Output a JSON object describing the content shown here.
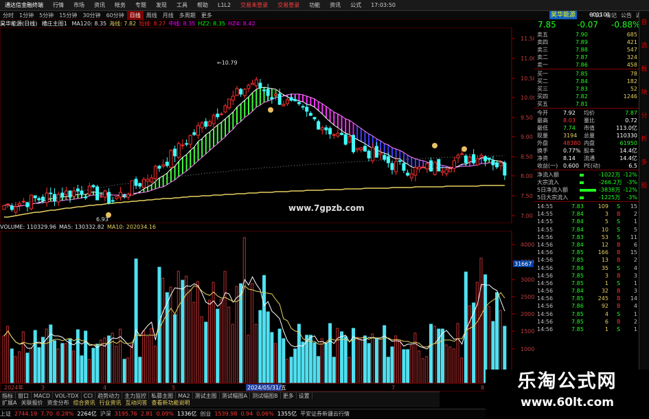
{
  "titlebar": {
    "items": [
      "通达信金融终端",
      "行情",
      "市场",
      "资讯",
      "帐务",
      "专题",
      "发现",
      "工具",
      "帮助",
      "L1L2",
      "交易未登录",
      "交易登录",
      "功能",
      "资讯",
      "公式",
      "17:03:50"
    ]
  },
  "toolbar": {
    "items": [
      "分时",
      "1分钟",
      "5分钟",
      "15分钟",
      "30分钟",
      "60分钟",
      "日线",
      "周线",
      "月线",
      "多周期",
      "更多"
    ],
    "active": 6
  },
  "rtool": {
    "items": [
      "F10",
      "标记",
      "公告",
      "返回"
    ]
  },
  "chart": {
    "stock": "昊华能源(日线)",
    "indicator": "槽庄主图1",
    "params": [
      {
        "t": "MA120: 8.35",
        "c": "#e0e0e0"
      },
      {
        "t": "海线: 7.82",
        "c": "#e8d060"
      },
      {
        "t": "短线: 8.27",
        "c": "#ff2020"
      },
      {
        "t": "中线: 8.35",
        "c": "#ff00ff"
      },
      {
        "t": "HZ2: 8.35",
        "c": "#00ff00"
      },
      {
        "t": "HZ4: 8.42",
        "c": "#ff00ff"
      }
    ],
    "yticks": [
      "11.50",
      "11.00",
      "10.50",
      "10.00",
      "9.50",
      "9.00",
      "8.50",
      "8.00",
      "7.50",
      "7.00"
    ],
    "high_label": "10.79",
    "low_label": "6.93",
    "watermark": "www.7gpzb.com"
  },
  "volume": {
    "legend": [
      {
        "t": "VOLUME: 110329.96",
        "c": "#e0e0e0"
      },
      {
        "t": "MA5: 130332.82",
        "c": "#e0e0e0"
      },
      {
        "t": "MA10: 202034.16",
        "c": "#e8d060"
      }
    ],
    "yticks": [
      "40000",
      "35000",
      "30000",
      "25000",
      "20000",
      "15000",
      "10000"
    ],
    "yunit": "X100",
    "marker": "31667",
    "dates": [
      "2024年",
      "3",
      "4",
      "5",
      "2024/05/31/五",
      "7",
      "8"
    ]
  },
  "quote": {
    "name": "昊华能源",
    "code": "601101",
    "price": "7.85",
    "change": "-0.07",
    "pct": "-0.88%",
    "sell": [
      {
        "l": "卖五",
        "p": "7.90",
        "v": "685"
      },
      {
        "l": "卖四",
        "p": "7.89",
        "v": "421"
      },
      {
        "l": "卖三",
        "p": "7.88",
        "v": "547"
      },
      {
        "l": "卖二",
        "p": "7.87",
        "v": "324"
      },
      {
        "l": "卖一",
        "p": "7.86",
        "v": "458"
      }
    ],
    "buy": [
      {
        "l": "买一",
        "p": "7.85",
        "v": "78"
      },
      {
        "l": "买二",
        "p": "7.84",
        "v": "182"
      },
      {
        "l": "买三",
        "p": "7.83",
        "v": "52"
      },
      {
        "l": "买四",
        "p": "7.82",
        "v": "1246"
      },
      {
        "l": "买五",
        "p": "7.81",
        "v": ""
      }
    ],
    "stats": [
      {
        "l1": "今开",
        "v1": "7.92",
        "c1": "#fff",
        "l2": "均价",
        "v2": "7.87",
        "c2": "#2f2"
      },
      {
        "l1": "最高",
        "v1": "8.03",
        "c1": "#f33",
        "l2": "量比",
        "v2": "0.72",
        "c2": "#fff"
      },
      {
        "l1": "最低",
        "v1": "7.74",
        "c1": "#2f2",
        "l2": "市值",
        "v2": "113.0亿",
        "c2": "#fff"
      },
      {
        "l1": "现量",
        "v1": "3194",
        "c1": "#e8d060",
        "l2": "总量",
        "v2": "110330",
        "c2": "#fff"
      },
      {
        "l1": "外盘",
        "v1": "48380",
        "c1": "#f33",
        "l2": "内盘",
        "v2": "61950",
        "c2": "#2f2"
      },
      {
        "l1": "换手",
        "v1": "0.77%",
        "c1": "#fff",
        "l2": "股本",
        "v2": "14.4亿",
        "c2": "#fff"
      },
      {
        "l1": "净资",
        "v1": "8.14",
        "c1": "#fff",
        "l2": "流通",
        "v2": "14.4亿",
        "c2": "#fff"
      },
      {
        "l1": "收益(一)",
        "v1": "0.600",
        "c1": "#fff",
        "l2": "PE(动)",
        "v2": "6.5",
        "c2": "#fff"
      }
    ],
    "flow": [
      {
        "l": "净流入额",
        "v": "-1022万",
        "p": "-12%"
      },
      {
        "l": "大宗流入",
        "v": "-266.2万",
        "p": "-3%"
      },
      {
        "l": "5日净流入额",
        "v": "-3838万",
        "p": "-12%"
      },
      {
        "l": "5日大宗流入",
        "v": "-1225万",
        "p": "-3%"
      }
    ],
    "ticks": [
      {
        "t": "14:55",
        "p": "7.83",
        "v": "109",
        "f": "S",
        "n": "15"
      },
      {
        "t": "14:55",
        "p": "7.84",
        "v": "3",
        "f": "B",
        "n": "2"
      },
      {
        "t": "14:55",
        "p": "7.84",
        "v": "5",
        "f": "S",
        "n": "1"
      },
      {
        "t": "14:55",
        "p": "7.84",
        "v": "10",
        "f": "S",
        "n": "5"
      },
      {
        "t": "14:56",
        "p": "7.83",
        "v": "53",
        "f": "S",
        "n": "11"
      },
      {
        "t": "14:56",
        "p": "7.84",
        "v": "12",
        "f": "B",
        "n": "6"
      },
      {
        "t": "14:56",
        "p": "7.85",
        "v": "166",
        "f": "B",
        "n": "15"
      },
      {
        "t": "14:56",
        "p": "7.85",
        "v": "13",
        "f": "B",
        "n": "2"
      },
      {
        "t": "14:56",
        "p": "7.84",
        "v": "35",
        "f": "S",
        "n": "4"
      },
      {
        "t": "14:56",
        "p": "7.85",
        "v": "3",
        "f": "B",
        "n": "3"
      },
      {
        "t": "14:56",
        "p": "7.85",
        "v": "1",
        "f": "S",
        "n": "1"
      },
      {
        "t": "14:56",
        "p": "7.84",
        "v": "32",
        "f": "B",
        "n": "3"
      },
      {
        "t": "14:56",
        "p": "7.85",
        "v": "245",
        "f": "B",
        "n": "14"
      },
      {
        "t": "14:56",
        "p": "7.86",
        "v": "92",
        "f": "B",
        "n": "4"
      },
      {
        "t": "14:56",
        "p": "7.85",
        "v": "4",
        "f": "S",
        "n": "1"
      },
      {
        "t": "14:56",
        "p": "7.85",
        "v": "6",
        "f": "B",
        "n": "2"
      },
      {
        "t": "14:56",
        "p": "7.85",
        "v": "1",
        "f": "S",
        "n": "1"
      }
    ]
  },
  "sidebar": [
    "自",
    "选",
    "板",
    "块",
    "分",
    "析",
    "多",
    "股"
  ],
  "bottom_tabs": [
    "指标",
    "窗口",
    "MACD",
    "VOL-TDX",
    "CCI",
    "趋势动力",
    "主力监控",
    "私募主图",
    "MA2",
    "测试主图",
    "测试幅图A",
    "测试幅图B",
    "更多",
    "设置"
  ],
  "bottom_tabs2": [
    "扩展A",
    "关联报价",
    "资金分布",
    "综合资讯",
    "行业资讯",
    "互动问答",
    "查看新功能说明"
  ],
  "status": [
    {
      "t": "上证",
      "c": "#c0c0c0"
    },
    {
      "t": "2744.19",
      "c": "#f33"
    },
    {
      "t": "7.70",
      "c": "#f33"
    },
    {
      "t": "0.28%",
      "c": "#f33"
    },
    {
      "t": "2264亿",
      "c": "#fff"
    },
    {
      "t": "沪深",
      "c": "#c0c0c0"
    },
    {
      "t": "3195.76",
      "c": "#f33"
    },
    {
      "t": "2.81",
      "c": "#f33"
    },
    {
      "t": "0.09%",
      "c": "#f33"
    },
    {
      "t": "1336亿",
      "c": "#fff"
    },
    {
      "t": "创业",
      "c": "#c0c0c0"
    },
    {
      "t": "1539.98",
      "c": "#f33"
    },
    {
      "t": "0.94",
      "c": "#f33"
    },
    {
      "t": "0.06%",
      "c": "#f33"
    },
    {
      "t": "1355亿",
      "c": "#fff"
    },
    {
      "t": "平安证券新疆云行情",
      "c": "#c0c0c0"
    }
  ],
  "site_watermark": {
    "title": "乐淘公式网",
    "url": "www.60lt.com"
  }
}
